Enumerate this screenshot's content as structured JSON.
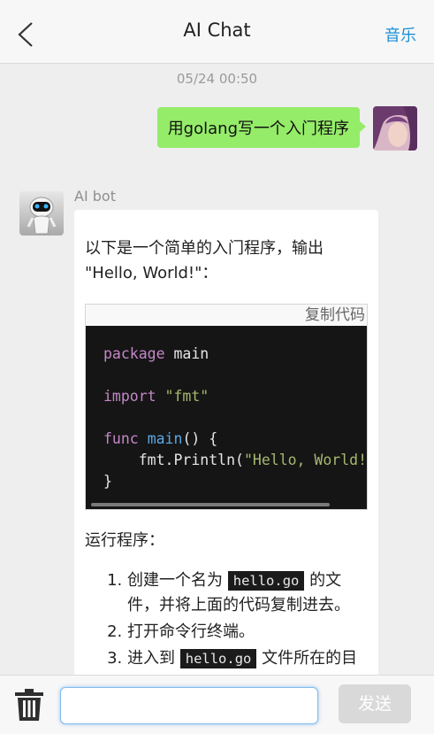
{
  "header": {
    "title": "AI Chat",
    "music_label": "音乐",
    "back_icon": "chevron-left-icon"
  },
  "conversation": {
    "timestamp": "05/24 00:50",
    "user_message": "用golang写一个入门程序",
    "bot_name": "AI bot",
    "bot_intro": "以下是一个简单的入门程序，输出 \"Hello, World!\"：",
    "copy_label": "复制代码",
    "code": {
      "line1_kw": "package",
      "line1_rest": " main",
      "line3_kw": "import",
      "line3_str": "\"fmt\"",
      "line5_kw": "func",
      "line5_fn": "main",
      "line5_rest": "() {",
      "line6_call": "    fmt.Println(",
      "line6_str": "\"Hello, World!\"",
      "line7": "}"
    },
    "run_title": "运行程序：",
    "steps": {
      "s1_before": "创建一个名为",
      "s1_code": "hello.go",
      "s1_after": "的文件，并将上面的代码复制进去。",
      "s2": "打开命令行终端。",
      "s3_before": "进入到",
      "s3_code": "hello.go",
      "s3_after": "文件所在的目录。"
    }
  },
  "footer": {
    "input_value": "",
    "input_placeholder": "",
    "send_label": "发送",
    "trash_icon": "trash-icon"
  },
  "colors": {
    "accent": "#1a8fd6",
    "user_bubble": "#95ec69",
    "code_bg": "#151515"
  }
}
